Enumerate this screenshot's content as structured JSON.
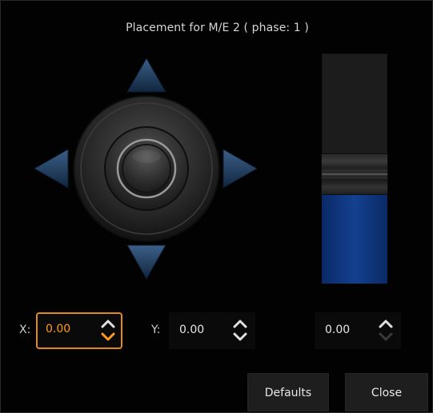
{
  "dialog": {
    "title": "Placement for M/E 2 ( phase: 1 )"
  },
  "joystick": {
    "up_arrow": "triangle-up-icon",
    "down_arrow": "triangle-down-icon",
    "left_arrow": "triangle-left-icon",
    "right_arrow": "triangle-right-icon",
    "arrow_color": "#1d3a5c",
    "knob_color": "#3a3a3a"
  },
  "slider": {
    "level_fraction": 0.41,
    "fill_color": "#14408f"
  },
  "fields": {
    "x": {
      "label": "X:",
      "value": "0.00",
      "accent": "#e08a1e"
    },
    "y": {
      "label": "Y:",
      "value": "0.00"
    },
    "z": {
      "value": "0.00"
    }
  },
  "buttons": {
    "defaults": "Defaults",
    "close": "Close"
  }
}
